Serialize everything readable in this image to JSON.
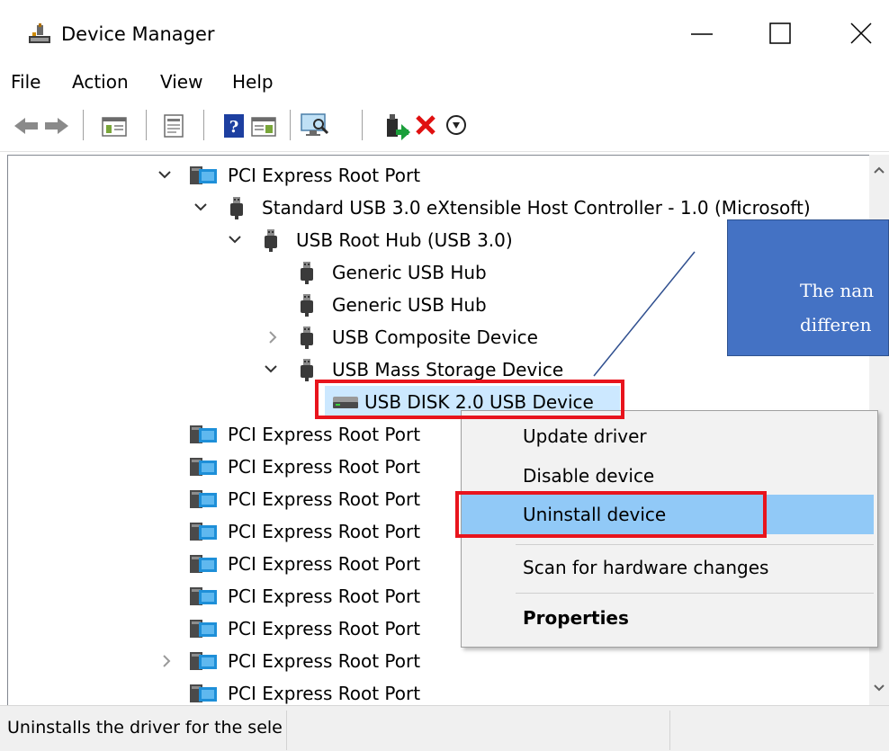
{
  "window": {
    "title": "Device Manager",
    "minimize_glyph": "—",
    "maximize_glyph": "☐",
    "close_glyph": "✕"
  },
  "menu": {
    "file": "File",
    "action": "Action",
    "view": "View",
    "help": "Help"
  },
  "toolbar": {
    "icons": [
      "back-arrow-icon",
      "forward-arrow-icon",
      "show-hide-console-tree-icon",
      "properties-icon",
      "help-icon",
      "action-pane-icon",
      "scan-hardware-icon",
      "update-driver-icon",
      "uninstall-device-icon",
      "enable-device-icon"
    ]
  },
  "tree": {
    "items": [
      {
        "label": "PCI Express Root Port",
        "icon": "pci-port-icon",
        "expanded": true
      },
      {
        "label": "Standard USB 3.0 eXtensible Host Controller - 1.0 (Microsoft)",
        "icon": "usb-plug-icon",
        "expanded": true
      },
      {
        "label": "USB Root Hub (USB 3.0)",
        "icon": "usb-plug-icon",
        "expanded": true
      },
      {
        "label": "Generic USB Hub",
        "icon": "usb-plug-icon"
      },
      {
        "label": "Generic USB Hub",
        "icon": "usb-plug-icon"
      },
      {
        "label": "USB Composite Device",
        "icon": "usb-plug-icon",
        "expanded": false
      },
      {
        "label": "USB Mass Storage Device",
        "icon": "usb-plug-icon",
        "expanded": true
      },
      {
        "label": "USB DISK 2.0 USB Device",
        "icon": "disk-drive-icon",
        "selected": true
      },
      {
        "label": "PCI Express Root Port",
        "icon": "pci-port-icon"
      },
      {
        "label": "PCI Express Root Port",
        "icon": "pci-port-icon"
      },
      {
        "label": "PCI Express Root Port",
        "icon": "pci-port-icon"
      },
      {
        "label": "PCI Express Root Port",
        "icon": "pci-port-icon"
      },
      {
        "label": "PCI Express Root Port",
        "icon": "pci-port-icon"
      },
      {
        "label": "PCI Express Root Port",
        "icon": "pci-port-icon"
      },
      {
        "label": "PCI Express Root Port",
        "icon": "pci-port-icon"
      },
      {
        "label": "PCI Express Root Port",
        "icon": "pci-port-icon",
        "expanded": false
      },
      {
        "label": "PCI Express Root Port",
        "icon": "pci-port-icon"
      }
    ]
  },
  "context_menu": {
    "update_driver": "Update driver",
    "disable_device": "Disable device",
    "uninstall_device": "Uninstall device",
    "scan_hardware": "Scan for hardware changes",
    "properties": "Properties"
  },
  "callout": {
    "line1": "The nan",
    "line2": "differen"
  },
  "status": {
    "text": "Uninstalls the driver for the sele"
  },
  "colors": {
    "selection_bg": "#cce8ff",
    "menu_highlight": "#91c9f7",
    "annotation_red": "#e8141d",
    "callout_blue": "#4472c4"
  }
}
